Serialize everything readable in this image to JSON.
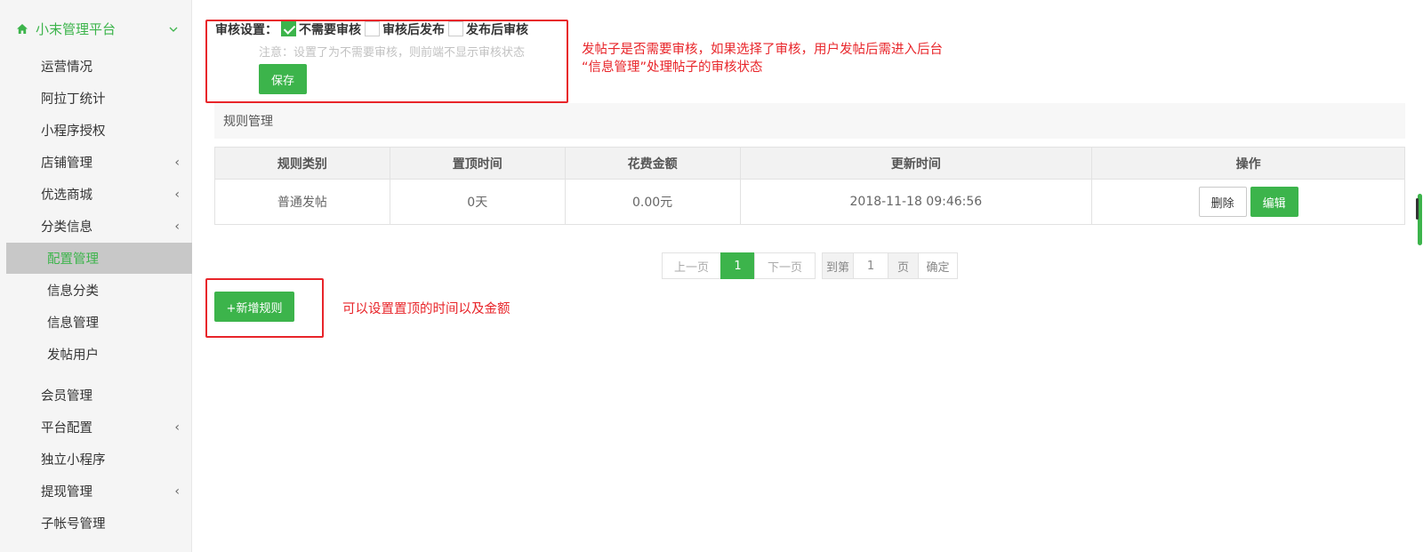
{
  "sidebar": {
    "header": "小末管理平台",
    "items": [
      {
        "label": "运营情况"
      },
      {
        "label": "阿拉丁统计"
      },
      {
        "label": "小程序授权"
      },
      {
        "label": "店铺管理"
      },
      {
        "label": "优选商城"
      },
      {
        "label": "分类信息"
      },
      {
        "label": "配置管理"
      },
      {
        "label": "信息分类"
      },
      {
        "label": "信息管理"
      },
      {
        "label": "发帖用户"
      },
      {
        "label": "会员管理"
      },
      {
        "label": "平台配置"
      },
      {
        "label": "独立小程序"
      },
      {
        "label": "提现管理"
      },
      {
        "label": "子帐号管理"
      }
    ]
  },
  "review": {
    "label": "审核设置：",
    "options": [
      {
        "label": "不需要审核",
        "checked": true
      },
      {
        "label": "审核后发布",
        "checked": false
      },
      {
        "label": "发布后审核",
        "checked": false
      }
    ],
    "note": "注意：设置了为不需要审核，则前端不显示审核状态",
    "save_label": "保存"
  },
  "annotations": {
    "review_line1": "发帖子是否需要审核，如果选择了审核，用户发帖后需进入后台",
    "review_line2": "“信息管理”处理帖子的审核状态",
    "add_rule": "可以设置置顶的时间以及金额"
  },
  "rules": {
    "section_title": "规则管理",
    "columns": [
      "规则类别",
      "置顶时间",
      "花费金额",
      "更新时间",
      "操作"
    ],
    "rows": [
      {
        "category": "普通发帖",
        "top_time": "0天",
        "cost": "0.00元",
        "updated": "2018-11-18 09:46:56"
      }
    ],
    "delete_label": "删除",
    "edit_label": "编辑"
  },
  "pagination": {
    "prev": "上一页",
    "current": "1",
    "next": "下一页",
    "goto": "到第",
    "page_input": "1",
    "page_unit": "页",
    "confirm": "确定"
  },
  "add_rule_label": "+新增规则",
  "colors": {
    "accent": "#3cb44b",
    "annotation": "#e8252a"
  }
}
